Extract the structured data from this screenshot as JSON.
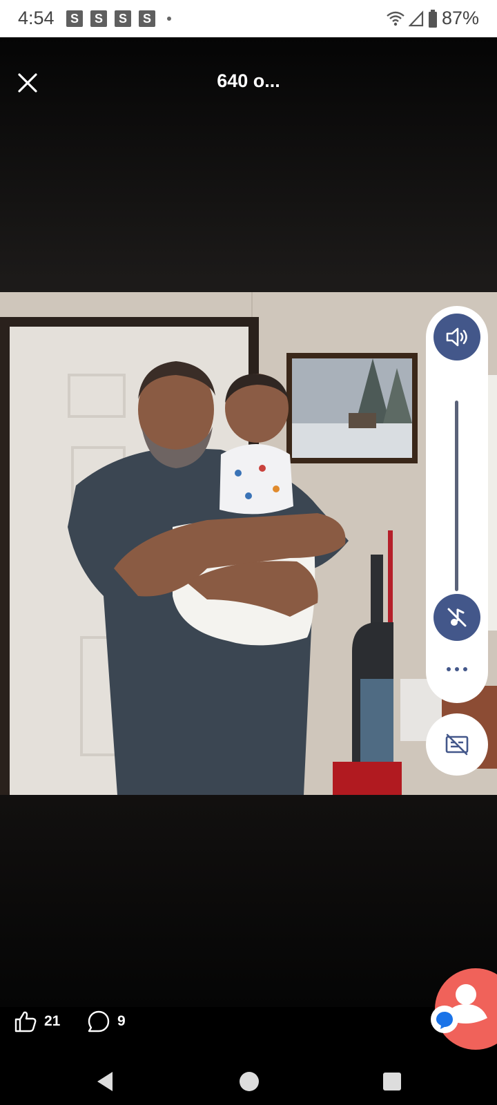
{
  "status_bar": {
    "time": "4:54",
    "notifications": [
      "S",
      "S",
      "S",
      "S"
    ],
    "battery_percent": "87%",
    "icons": [
      "wifi-icon",
      "signal-icon",
      "battery-icon"
    ]
  },
  "viewer": {
    "title": "640 o...",
    "close_icon": "close-icon"
  },
  "volume_panel": {
    "icons": [
      "speaker-icon",
      "mute-icon",
      "more-options-icon"
    ],
    "accent_color": "#43578a"
  },
  "caption_toggle": {
    "icon": "captions-off-icon"
  },
  "actions": {
    "like_count": "21",
    "comment_count": "9"
  },
  "chat_head": {
    "color": "#f0625a",
    "icon": "messenger-icon"
  },
  "nav_bar": {
    "icons": [
      "back-icon",
      "home-icon",
      "recents-icon"
    ]
  }
}
